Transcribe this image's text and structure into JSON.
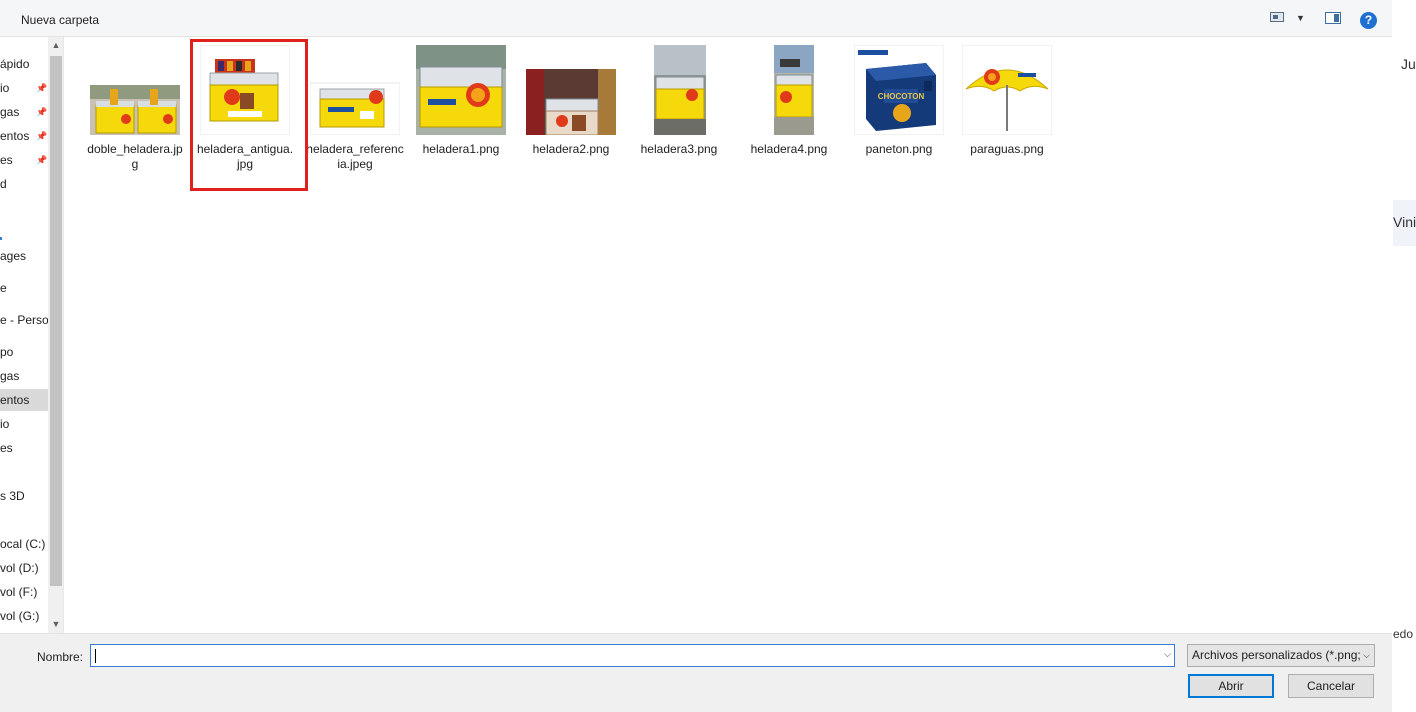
{
  "toolbar": {
    "new_folder_label": "Nueva carpeta",
    "help_label": "?"
  },
  "nav": {
    "items": [
      {
        "label": "ápido",
        "pinned": false
      },
      {
        "label": "io",
        "pinned": true
      },
      {
        "label": "gas",
        "pinned": true
      },
      {
        "label": "entos",
        "pinned": true
      },
      {
        "label": "es",
        "pinned": true
      },
      {
        "label": "d",
        "pinned": false
      },
      {
        "label": "",
        "pinned": false
      },
      {
        "label": "ages",
        "pinned": false
      },
      {
        "label": "e",
        "pinned": false
      },
      {
        "label": "e - Person",
        "pinned": false
      },
      {
        "label": "po",
        "pinned": false
      },
      {
        "label": "gas",
        "pinned": false
      },
      {
        "label": "entos",
        "pinned": false,
        "selected": true
      },
      {
        "label": "io",
        "pinned": false
      },
      {
        "label": "es",
        "pinned": false
      },
      {
        "label": "s 3D",
        "pinned": false
      },
      {
        "label": "ocal (C:)",
        "pinned": false
      },
      {
        "label": "vol (D:)",
        "pinned": false
      },
      {
        "label": "vol (F:)",
        "pinned": false
      },
      {
        "label": "vol (G:)",
        "pinned": false
      }
    ]
  },
  "files": [
    {
      "name": "doble_heladera.jpg",
      "thumb": "double-freezer"
    },
    {
      "name": "heladera_antigua.jpg",
      "thumb": "old-freezer",
      "highlighted": true
    },
    {
      "name": "heladera_referencia.jpeg",
      "thumb": "reference-freezer"
    },
    {
      "name": "heladera1.png",
      "thumb": "freezer-photo-1"
    },
    {
      "name": "heladera2.png",
      "thumb": "freezer-photo-2"
    },
    {
      "name": "heladera3.png",
      "thumb": "freezer-photo-3"
    },
    {
      "name": "heladera4.png",
      "thumb": "freezer-photo-4"
    },
    {
      "name": "paneton.png",
      "thumb": "paneton-box"
    },
    {
      "name": "paraguas.png",
      "thumb": "umbrella"
    }
  ],
  "bottom": {
    "name_label": "Nombre:",
    "name_value": "",
    "file_type": "Archivos personalizados (*.png;",
    "open_label": "Abrir",
    "cancel_label": "Cancelar"
  },
  "background": {
    "texts": [
      "Ju",
      "Vini",
      "edo"
    ]
  },
  "colors": {
    "highlight": "#e0201c",
    "brand_yellow": "#f5d90a",
    "accent": "#0078d7"
  }
}
